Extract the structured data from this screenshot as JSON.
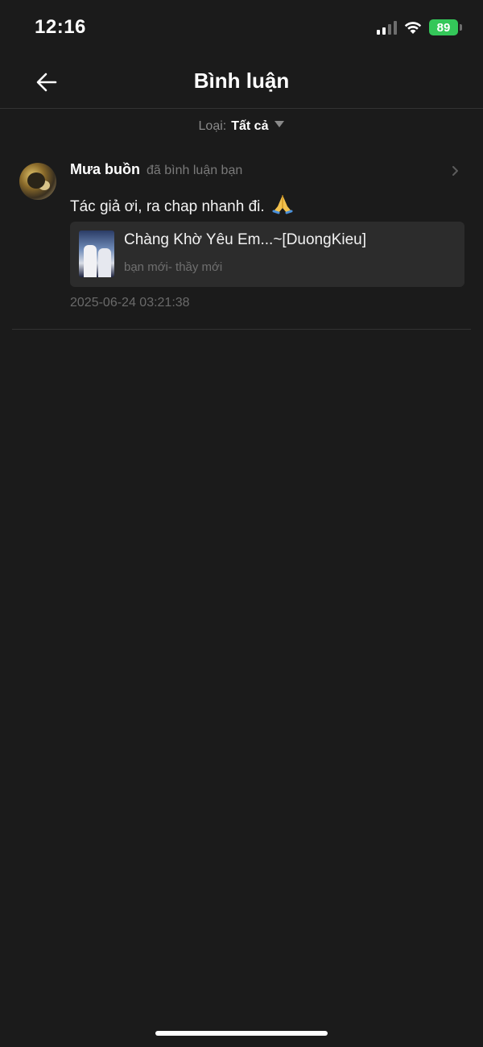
{
  "status_bar": {
    "time": "12:16",
    "battery_level": "89",
    "signal_icon": "cellular-signal-icon",
    "wifi_icon": "wifi-icon",
    "battery_color": "#34c759"
  },
  "header": {
    "title": "Bình luận",
    "back_icon": "arrow-left-icon"
  },
  "filter": {
    "label": "Loại:",
    "value": "Tất cả",
    "caret_icon": "caret-down-icon"
  },
  "comments": [
    {
      "user_name": "Mưa buồn",
      "action_text": "đã bình luận bạn",
      "text": "Tác giả ơi, ra chap nhanh đi.",
      "emoji_icon": "folded-hands-emoji",
      "story": {
        "title": "Chàng Khờ Yêu Em...~[DuongKieu]",
        "subtitle": "bạn mới- thầy mới"
      },
      "timestamp": "2025-06-24 03:21:38"
    }
  ],
  "colors": {
    "background": "#1b1b1b",
    "card": "#2c2c2c",
    "divider": "#333333",
    "muted_text": "#7a7a7a"
  }
}
